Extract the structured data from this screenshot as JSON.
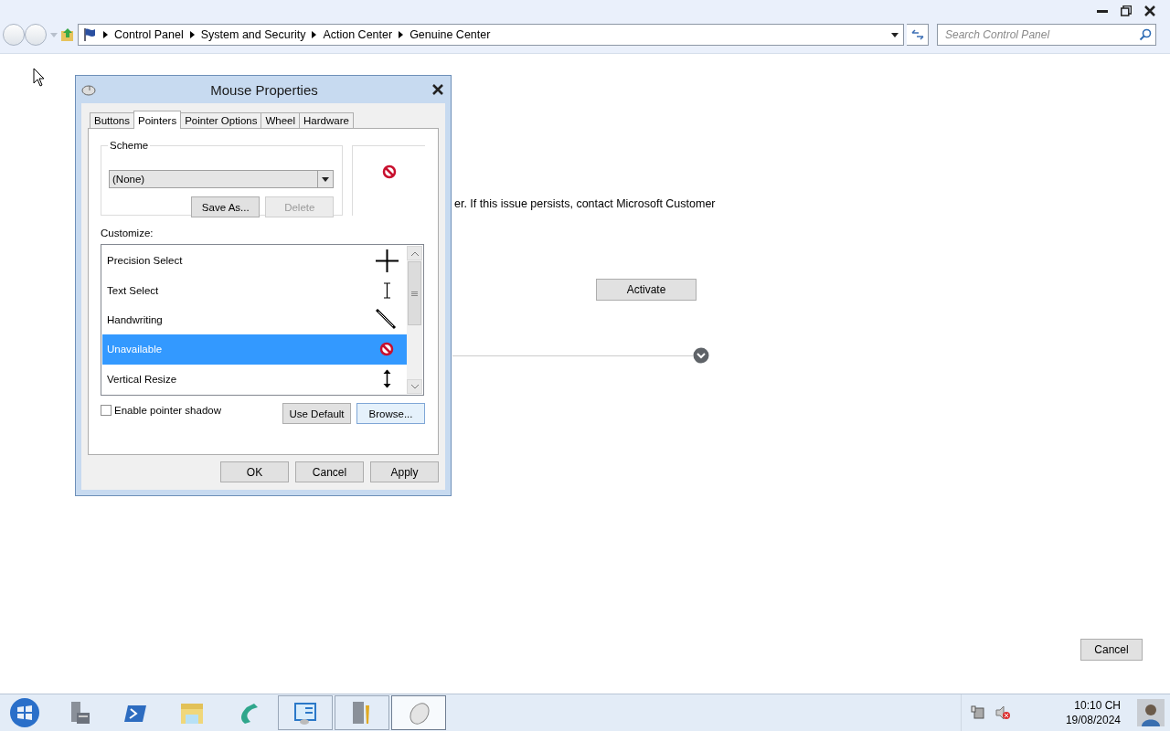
{
  "address_bar": {
    "breadcrumbs": [
      "Control Panel",
      "System and Security",
      "Action Center",
      "Genuine Center"
    ]
  },
  "search": {
    "placeholder": "Search Control Panel"
  },
  "page": {
    "message": "er. If this issue persists, contact Microsoft Customer",
    "activate_button": "Activate",
    "cancel_button": "Cancel"
  },
  "dialog": {
    "title": "Mouse Properties",
    "tabs": [
      {
        "label": "Buttons",
        "selected": false
      },
      {
        "label": "Pointers",
        "selected": true
      },
      {
        "label": "Pointer Options",
        "selected": false
      },
      {
        "label": "Wheel",
        "selected": false
      },
      {
        "label": "Hardware",
        "selected": false
      }
    ],
    "scheme": {
      "label": "Scheme",
      "value": "(None)",
      "buttons": [
        {
          "label": "Save As...",
          "disabled": false
        },
        {
          "label": "Delete",
          "disabled": true
        }
      ]
    },
    "customize_label": "Customize:",
    "cursors": [
      {
        "name": "Precision Select",
        "kind": "crosshair",
        "selected": false
      },
      {
        "name": "Text Select",
        "kind": "ibeam",
        "selected": false
      },
      {
        "name": "Handwriting",
        "kind": "pen",
        "selected": false
      },
      {
        "name": "Unavailable",
        "kind": "no",
        "selected": true
      },
      {
        "name": "Vertical Resize",
        "kind": "vresize",
        "selected": false
      }
    ],
    "pointer_shadow": {
      "label": "Enable pointer shadow",
      "checked": false
    },
    "buttons": [
      "Use Default",
      "Browse..."
    ],
    "footer_buttons": [
      "OK",
      "Cancel",
      "Apply"
    ]
  },
  "taskbar": {
    "apps": [
      {
        "kind": "server",
        "running": false,
        "selected": false
      },
      {
        "kind": "shell",
        "running": false,
        "selected": false
      },
      {
        "kind": "folder",
        "running": false,
        "selected": false
      },
      {
        "kind": "dragon",
        "running": false,
        "selected": false
      },
      {
        "kind": "panel",
        "running": true,
        "selected": false
      },
      {
        "kind": "tools",
        "running": true,
        "selected": false
      },
      {
        "kind": "mouse",
        "running": true,
        "selected": true
      }
    ],
    "clock": {
      "time": "10:10 CH",
      "date": "19/08/2024"
    }
  }
}
